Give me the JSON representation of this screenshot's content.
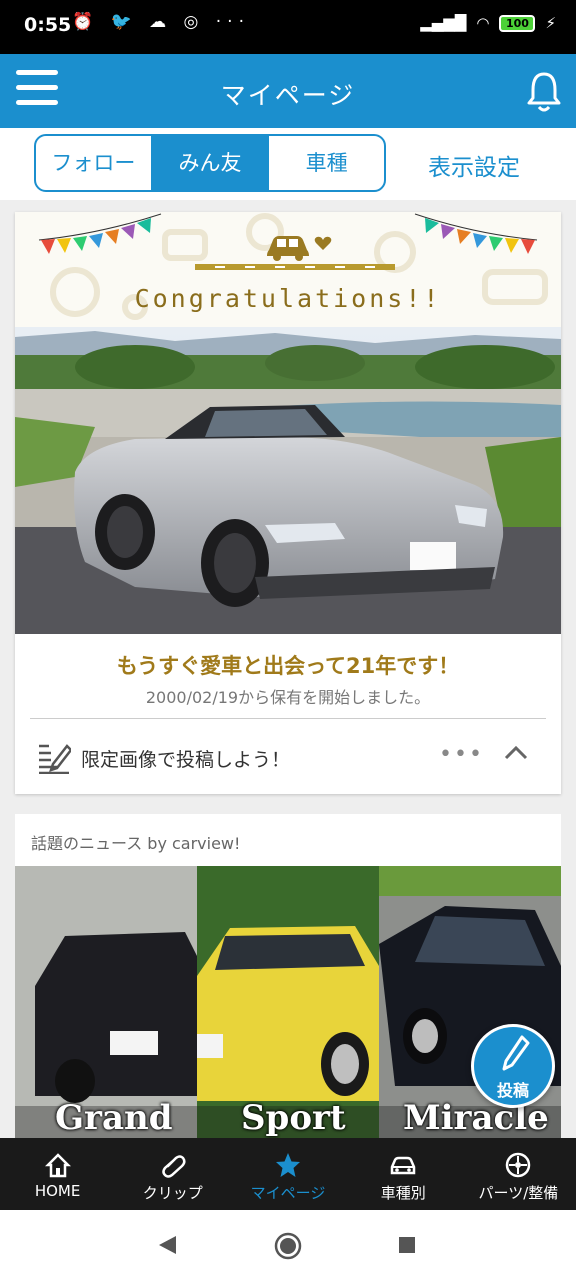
{
  "status_bar": {
    "time": "0:55",
    "battery": "100",
    "colors": {
      "bg": "#000000"
    }
  },
  "header": {
    "title": "マイページ",
    "menu_icon": "hamburger-icon",
    "bell_icon": "bell-icon"
  },
  "tabs": [
    {
      "label": "フォロー",
      "active": false
    },
    {
      "label": "みん友",
      "active": true
    },
    {
      "label": "車種",
      "active": false
    }
  ],
  "display_settings": "表示設定",
  "congrats_card": {
    "banner_text": "Congratulations!!",
    "message": "もうすぐ愛車と出会って21年です！",
    "sub_message": "2000/02/19から保有を開始しました。",
    "post_prompt": "限定画像で投稿しよう！",
    "more": "•••"
  },
  "news": {
    "heading": "話題のニュース by carview!",
    "panels": [
      "Grand",
      "Sport",
      "Miracle"
    ]
  },
  "fab": {
    "label": "投稿",
    "icon": "pencil-icon"
  },
  "bottom_nav": [
    {
      "label": "HOME",
      "icon": "home-icon",
      "active": false
    },
    {
      "label": "クリップ",
      "icon": "paperclip-icon",
      "active": false
    },
    {
      "label": "マイページ",
      "icon": "star-icon",
      "active": true
    },
    {
      "label": "車種別",
      "icon": "car-icon",
      "active": false
    },
    {
      "label": "パーツ/整備",
      "icon": "wheel-icon",
      "active": false
    }
  ],
  "colors": {
    "accent": "#1b8fce",
    "gold": "#a07a1a",
    "nav_bg": "#1a1a1a"
  }
}
